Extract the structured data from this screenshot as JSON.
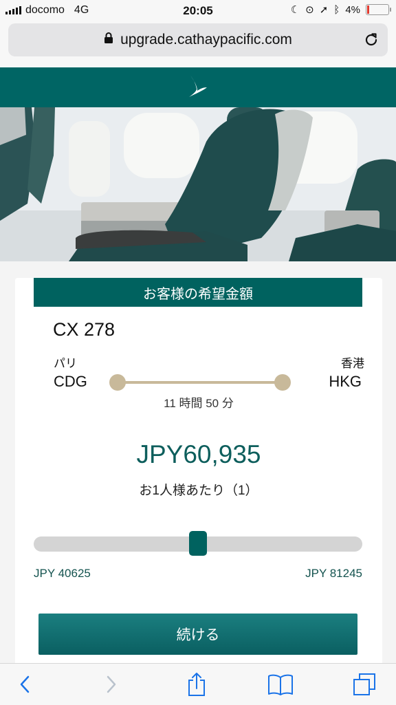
{
  "status_bar": {
    "carrier": "docomo",
    "network": "4G",
    "time": "20:05",
    "battery": "4%"
  },
  "browser": {
    "url": "upgrade.cathaypacific.com",
    "icons": [
      "lock-icon",
      "reload-icon",
      "back-icon",
      "forward-icon",
      "share-icon",
      "bookmarks-icon",
      "tabs-icon"
    ]
  },
  "brand": {
    "logo": "cathay-brushwing-logo",
    "color": "#006564"
  },
  "bid_card": {
    "title": "お客様の希望金額",
    "flight_number": "CX 278",
    "origin_city": "パリ",
    "origin_code": "CDG",
    "destination_city": "香港",
    "destination_code": "HKG",
    "duration": "11 時間 50 分",
    "price": "JPY60,935",
    "per_person": "お1人様あたり（1）",
    "slider": {
      "min_label": "JPY 40625",
      "max_label": "JPY 81245",
      "min": 40625,
      "max": 81245,
      "value": 60935
    },
    "continue_label": "続ける"
  },
  "colors": {
    "accent": "#00625f",
    "route": "#c8b99a"
  }
}
